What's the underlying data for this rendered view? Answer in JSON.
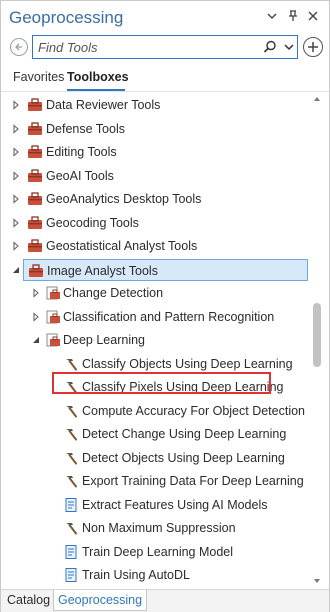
{
  "header": {
    "title": "Geoprocessing",
    "icons": [
      "chevron-down-icon",
      "pin-icon",
      "close-icon"
    ]
  },
  "search": {
    "placeholder": "Find Tools",
    "value": ""
  },
  "tabs": [
    {
      "label": "Favorites",
      "active": false
    },
    {
      "label": "Toolboxes",
      "active": true
    }
  ],
  "tree": {
    "toolboxes": [
      {
        "label": "Data Reviewer Tools"
      },
      {
        "label": "Defense Tools"
      },
      {
        "label": "Editing Tools"
      },
      {
        "label": "GeoAI Tools"
      },
      {
        "label": "GeoAnalytics Desktop Tools"
      },
      {
        "label": "Geocoding Tools"
      },
      {
        "label": "Geostatistical Analyst Tools"
      },
      {
        "label": "Image Analyst Tools",
        "expanded": true,
        "selected": true
      }
    ],
    "toolsets": [
      {
        "label": "Change Detection"
      },
      {
        "label": "Classification and Pattern Recognition"
      },
      {
        "label": "Deep Learning",
        "expanded": true
      }
    ],
    "tools": [
      {
        "label": "Classify Objects Using Deep Learning",
        "icon": "hammer-tool-icon"
      },
      {
        "label": "Classify Pixels Using Deep Learning",
        "icon": "hammer-tool-icon",
        "highlighted": true
      },
      {
        "label": "Compute Accuracy For Object Detection",
        "icon": "hammer-tool-icon"
      },
      {
        "label": "Detect Change Using Deep Learning",
        "icon": "hammer-tool-icon"
      },
      {
        "label": "Detect Objects Using Deep Learning",
        "icon": "hammer-tool-icon"
      },
      {
        "label": "Export Training Data For Deep Learning",
        "icon": "hammer-tool-icon"
      },
      {
        "label": "Extract Features Using AI Models",
        "icon": "script-tool-icon"
      },
      {
        "label": "Non Maximum Suppression",
        "icon": "hammer-tool-icon"
      },
      {
        "label": "Train Deep Learning Model",
        "icon": "script-tool-icon"
      },
      {
        "label": "Train Using AutoDL",
        "icon": "script-tool-icon"
      }
    ]
  },
  "bottom_tabs": [
    {
      "label": "Catalog",
      "active": false
    },
    {
      "label": "Geoprocessing",
      "active": true
    }
  ],
  "colors": {
    "accent": "#2f76c4",
    "title": "#3a6ea5",
    "selection_bg": "#d7e9f9",
    "highlight_border": "#e03232",
    "toolbox_red": "#c94f3b"
  }
}
